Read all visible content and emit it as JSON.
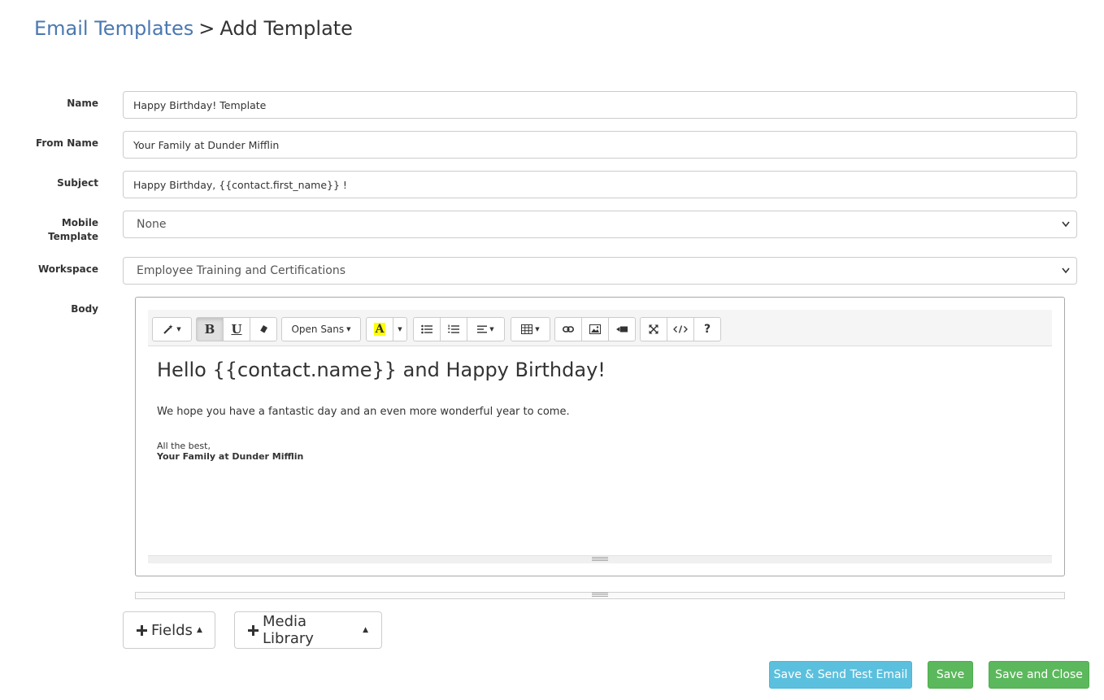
{
  "breadcrumb": {
    "parent": "Email Templates",
    "separator": ">",
    "current": "Add Template"
  },
  "form": {
    "name_label": "Name",
    "name_value": "Happy Birthday! Template",
    "from_name_label": "From Name",
    "from_name_value": "Your Family at Dunder Mifflin",
    "subject_label": "Subject",
    "subject_value": "Happy Birthday, {{contact.first_name}} !",
    "mobile_template_label_line1": "Mobile",
    "mobile_template_label_line2": "Template",
    "mobile_template_value": "None",
    "workspace_label": "Workspace",
    "workspace_value": "Employee Training and Certifications",
    "body_label": "Body"
  },
  "toolbar": {
    "font_name": "Open Sans",
    "bold": "B",
    "underline": "U",
    "font_color_letter": "A",
    "help": "?",
    "highlight_color": "#ffff00",
    "icons": [
      "magic-icon",
      "bold-icon",
      "underline-icon",
      "eraser-icon",
      "font-color-icon",
      "unordered-list-icon",
      "ordered-list-icon",
      "align-icon",
      "table-icon",
      "link-icon",
      "image-icon",
      "video-icon",
      "fullscreen-icon",
      "code-view-icon",
      "help-icon"
    ]
  },
  "editor": {
    "heading": "Hello {{contact.name}} and Happy Birthday!",
    "paragraph": "We hope you have a fantastic day and an even more wonderful year to come.",
    "signoff": "All the best,",
    "signature": "Your Family at Dunder Mifflin"
  },
  "buttons": {
    "fields": "Fields",
    "media_library": "Media Library",
    "save_send_test": "Save & Send Test Email",
    "save": "Save",
    "save_close": "Save and Close"
  },
  "colors": {
    "link": "#4a78b0",
    "info": "#5bc0de",
    "success": "#5cb85c",
    "border": "#cccccc"
  }
}
